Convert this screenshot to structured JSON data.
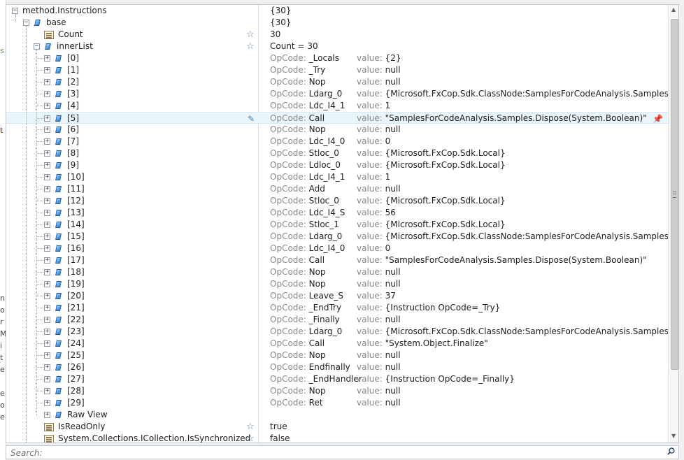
{
  "tree": {
    "root": {
      "name": "method.Instructions",
      "value": "{30}"
    },
    "base": {
      "name": "base",
      "value": "{30}"
    },
    "count": {
      "name": "Count",
      "value": "30"
    },
    "innerList": {
      "name": "innerList",
      "value": "Count = 30"
    },
    "opcode_label": "OpCode:",
    "value_label": "value:",
    "items": [
      {
        "index": "[0]",
        "opcode": "_Locals",
        "value": "{2}"
      },
      {
        "index": "[1]",
        "opcode": "_Try",
        "value": "null"
      },
      {
        "index": "[2]",
        "opcode": "Nop",
        "value": "null"
      },
      {
        "index": "[3]",
        "opcode": "Ldarg_0",
        "value": "{Microsoft.FxCop.Sdk.ClassNode:SamplesForCodeAnalysis.Samples this}"
      },
      {
        "index": "[4]",
        "opcode": "Ldc_I4_1",
        "value": "1"
      },
      {
        "index": "[5]",
        "opcode": "Call",
        "value": "\"SamplesForCodeAnalysis.Samples.Dispose(System.Boolean)\""
      },
      {
        "index": "[6]",
        "opcode": "Nop",
        "value": "null"
      },
      {
        "index": "[7]",
        "opcode": "Ldc_I4_0",
        "value": "0"
      },
      {
        "index": "[8]",
        "opcode": "Stloc_0",
        "value": "{Microsoft.FxCop.Sdk.Local}"
      },
      {
        "index": "[9]",
        "opcode": "Ldloc_0",
        "value": "{Microsoft.FxCop.Sdk.Local}"
      },
      {
        "index": "[10]",
        "opcode": "Ldc_I4_1",
        "value": "1"
      },
      {
        "index": "[11]",
        "opcode": "Add",
        "value": "null"
      },
      {
        "index": "[12]",
        "opcode": "Stloc_0",
        "value": "{Microsoft.FxCop.Sdk.Local}"
      },
      {
        "index": "[13]",
        "opcode": "Ldc_I4_S",
        "value": "56"
      },
      {
        "index": "[14]",
        "opcode": "Stloc_1",
        "value": "{Microsoft.FxCop.Sdk.Local}"
      },
      {
        "index": "[15]",
        "opcode": "Ldarg_0",
        "value": "{Microsoft.FxCop.Sdk.ClassNode:SamplesForCodeAnalysis.Samples this}"
      },
      {
        "index": "[16]",
        "opcode": "Ldc_I4_0",
        "value": "0"
      },
      {
        "index": "[17]",
        "opcode": "Call",
        "value": "\"SamplesForCodeAnalysis.Samples.Dispose(System.Boolean)\""
      },
      {
        "index": "[18]",
        "opcode": "Nop",
        "value": "null"
      },
      {
        "index": "[19]",
        "opcode": "Nop",
        "value": "null"
      },
      {
        "index": "[20]",
        "opcode": "Leave_S",
        "value": "37"
      },
      {
        "index": "[21]",
        "opcode": "_EndTry",
        "value": "{Instruction OpCode=_Try}"
      },
      {
        "index": "[22]",
        "opcode": "_Finally",
        "value": "null"
      },
      {
        "index": "[23]",
        "opcode": "Ldarg_0",
        "value": "{Microsoft.FxCop.Sdk.ClassNode:SamplesForCodeAnalysis.Samples this}"
      },
      {
        "index": "[24]",
        "opcode": "Call",
        "value": "\"System.Object.Finalize\""
      },
      {
        "index": "[25]",
        "opcode": "Nop",
        "value": "null"
      },
      {
        "index": "[26]",
        "opcode": "Endfinally",
        "value": "null"
      },
      {
        "index": "[27]",
        "opcode": "_EndHandler",
        "value": "{Instruction OpCode=_Finally}"
      },
      {
        "index": "[28]",
        "opcode": "Nop",
        "value": "null"
      },
      {
        "index": "[29]",
        "opcode": "Ret",
        "value": "null"
      }
    ],
    "rawView": {
      "name": "Raw View"
    },
    "isReadOnly": {
      "name": "IsReadOnly",
      "value": "true"
    },
    "isSynchronized": {
      "name": "System.Collections.ICollection.IsSynchronized",
      "value": "false"
    }
  },
  "search": {
    "placeholder": "Search:"
  },
  "icons": {
    "property": "property-icon",
    "list": "list-icon",
    "favorite": "star-icon",
    "pin": "pin-icon",
    "search": "search-icon"
  },
  "colors": {
    "selection": "#eaf4fb",
    "label_gray": "#8a8a8a",
    "border": "#bfc7d3"
  }
}
